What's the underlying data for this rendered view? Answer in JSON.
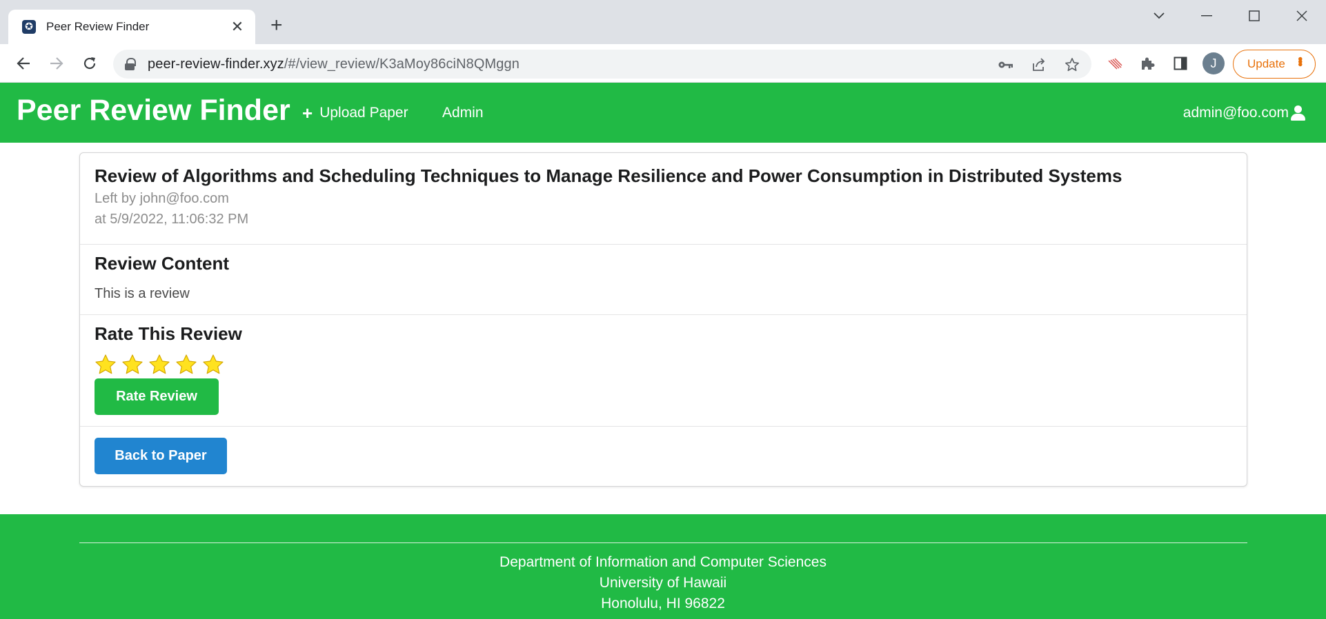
{
  "browser": {
    "tab_title": "Peer Review Finder",
    "url_host": "peer-review-finder.xyz",
    "url_path": "/#/view_review/K3aMoy86ciN8QMggn",
    "profile_initial": "J",
    "update_label": "Update"
  },
  "navbar": {
    "brand": "Peer Review Finder",
    "upload_label": "Upload Paper",
    "admin_label": "Admin",
    "user_email": "admin@foo.com"
  },
  "review": {
    "title": "Review of Algorithms and Scheduling Techniques to Manage Resilience and Power Consumption in Distributed Systems",
    "left_by": "Left by john@foo.com",
    "timestamp": "at 5/9/2022, 11:06:32 PM",
    "content_heading": "Review Content",
    "content_text": "This is a review",
    "rate_heading": "Rate This Review",
    "rating_stars": 5,
    "rating_max": 5,
    "rate_button": "Rate Review",
    "back_button": "Back to Paper"
  },
  "footer": {
    "line1": "Department of Information and Computer Sciences",
    "line2": "University of Hawaii",
    "line3": "Honolulu, HI 96822"
  },
  "colors": {
    "primary_green": "#21ba45",
    "primary_blue": "#2185d0",
    "star_yellow": "#ffe21f",
    "update_orange": "#e8710a"
  }
}
